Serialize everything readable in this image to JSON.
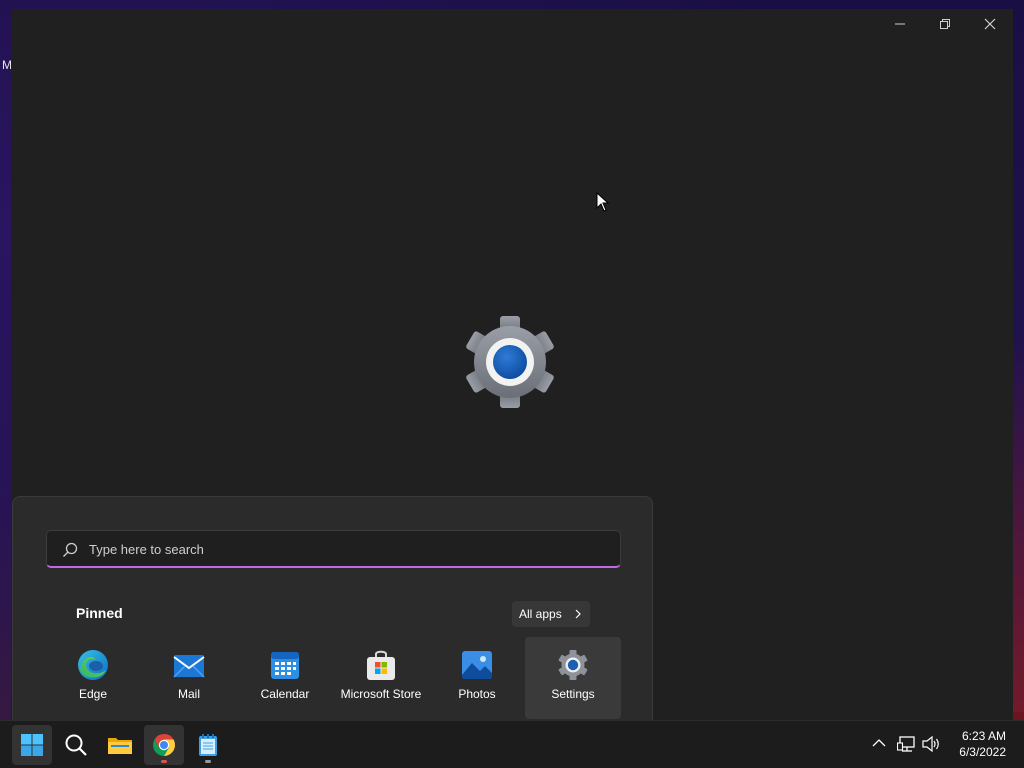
{
  "desktop": {
    "label": "M"
  },
  "window": {
    "controls": {
      "minimize": "minimize",
      "restore": "restore",
      "close": "close"
    }
  },
  "start_menu": {
    "search": {
      "placeholder": "Type here to search",
      "value": ""
    },
    "pinned_label": "Pinned",
    "all_apps_label": "All apps",
    "apps": [
      {
        "name": "Edge",
        "icon": "edge-icon"
      },
      {
        "name": "Mail",
        "icon": "mail-icon"
      },
      {
        "name": "Calendar",
        "icon": "calendar-icon"
      },
      {
        "name": "Microsoft Store",
        "icon": "store-icon"
      },
      {
        "name": "Photos",
        "icon": "photos-icon"
      },
      {
        "name": "Settings",
        "icon": "settings-icon"
      }
    ]
  },
  "taskbar": {
    "apps": [
      "start-icon",
      "search-icon",
      "file-explorer-icon",
      "chrome-icon",
      "notepad-icon"
    ],
    "clock": {
      "time": "6:23 AM",
      "date": "6/3/2022"
    }
  },
  "colors": {
    "accent": "#c06ae6",
    "window_bg": "#202020",
    "start_bg": "#2b2b2b"
  }
}
